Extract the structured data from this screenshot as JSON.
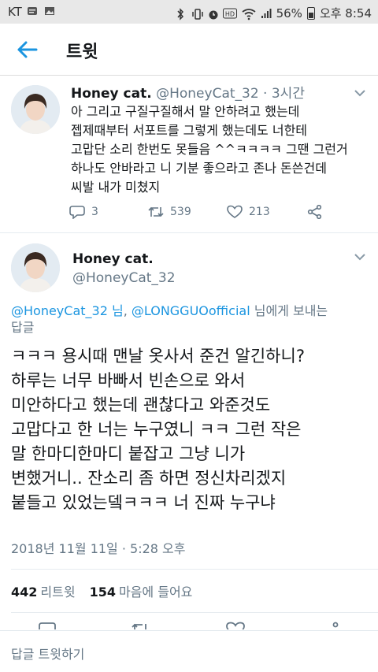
{
  "status_bar": {
    "carrier": "KT",
    "battery": "56%",
    "time": "오후 8:54",
    "icons": [
      "notification-icon",
      "image-icon",
      "bluetooth-icon",
      "vibrate-icon",
      "alarm-icon",
      "hd-icon",
      "wifi-icon",
      "signal-icon",
      "battery-icon"
    ]
  },
  "header": {
    "title": "트윗",
    "back_icon": "arrow-left-icon"
  },
  "parent_tweet": {
    "name": "Honey cat.",
    "meta": "@HoneyCat_32 · 3시간",
    "lines": [
      "아 그리고 구질구질해서 말 안하려고 했는데",
      "젭제때부터 서포트를 그렇게 했는데도 너한테",
      "고맙단 소리 한번도 못들음 ^^ㅋㅋㅋㅋ 그땐 그런거",
      "하나도 안바라고 니 기분 좋으라고 존나 돈쓴건데",
      "씨발 내가 미쳤지"
    ],
    "replies": "3",
    "retweets": "539",
    "likes": "213"
  },
  "main_tweet": {
    "name": "Honey cat.",
    "handle": "@HoneyCat_32",
    "reply_link1": "@HoneyCat_32 님",
    "reply_sep": ", ",
    "reply_link2": "@LONGGUOofficial",
    "reply_suffix": " 님에게 보내는",
    "reply_line2": "답글",
    "lines": [
      "ㅋㅋㅋ 용시때 맨날 옷사서 준건 알긴하니?",
      "하루는 너무 바빠서 빈손으로 와서",
      "미안하다고 했는데 괜찮다고 와준것도",
      "고맙다고 한 너는 누구였니 ㅋㅋ 그런 작은",
      "말 한마디한마디 붙잡고 그냥 니가",
      "변했거니.. 잔소리 좀 하면 정신차리겠지",
      "붙들고 있었는뎈ㅋㅋㅋ 너 진짜 누구냐"
    ],
    "timestamp": "2018년 11월 11일 · 5:28 오후",
    "retweet_count": "442",
    "retweet_label": "리트윗",
    "like_count": "154",
    "like_label": "마음에 들어요"
  },
  "reply_bar": {
    "placeholder": "답글 트윗하기"
  },
  "colors": {
    "accent": "#1b95e0",
    "secondary_text": "#657786",
    "primary_text": "#14171a",
    "status_bar_bg": "#e8e8e8"
  }
}
